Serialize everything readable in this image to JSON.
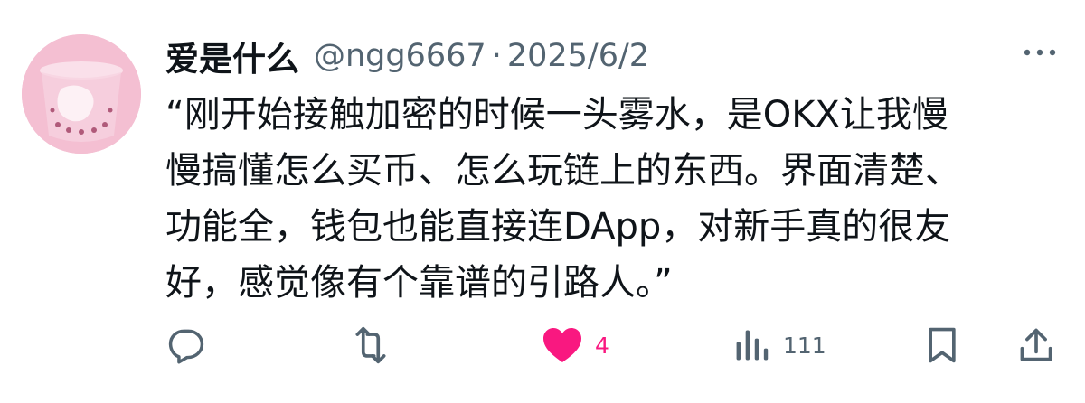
{
  "tweet": {
    "display_name": "爱是什么",
    "handle": "@ngg6667",
    "separator": "·",
    "date": "2025/6/2",
    "text_lines": [
      "“刚开始接触加密的时候一头雾水，是OKX让我慢",
      "慢搞懂怎么买币、怎么玩链上的东西。界面清楚、",
      "功能全，钱包也能直接连DApp，对新手真的很友",
      "好，感觉像有个靠谱的引路人。”"
    ]
  },
  "actions": {
    "reply": {
      "icon": "reply-icon",
      "count": ""
    },
    "retweet": {
      "icon": "retweet-icon",
      "count": ""
    },
    "like": {
      "icon": "heart-icon",
      "count": "4",
      "liked": true
    },
    "views": {
      "icon": "views-icon",
      "count": "111"
    },
    "bookmark": {
      "icon": "bookmark-icon",
      "count": ""
    },
    "share": {
      "icon": "share-icon",
      "count": ""
    }
  },
  "colors": {
    "text_primary": "#0f1419",
    "text_secondary": "#536471",
    "like_active": "#f91880",
    "avatar_bg": "#f3b9cd"
  }
}
